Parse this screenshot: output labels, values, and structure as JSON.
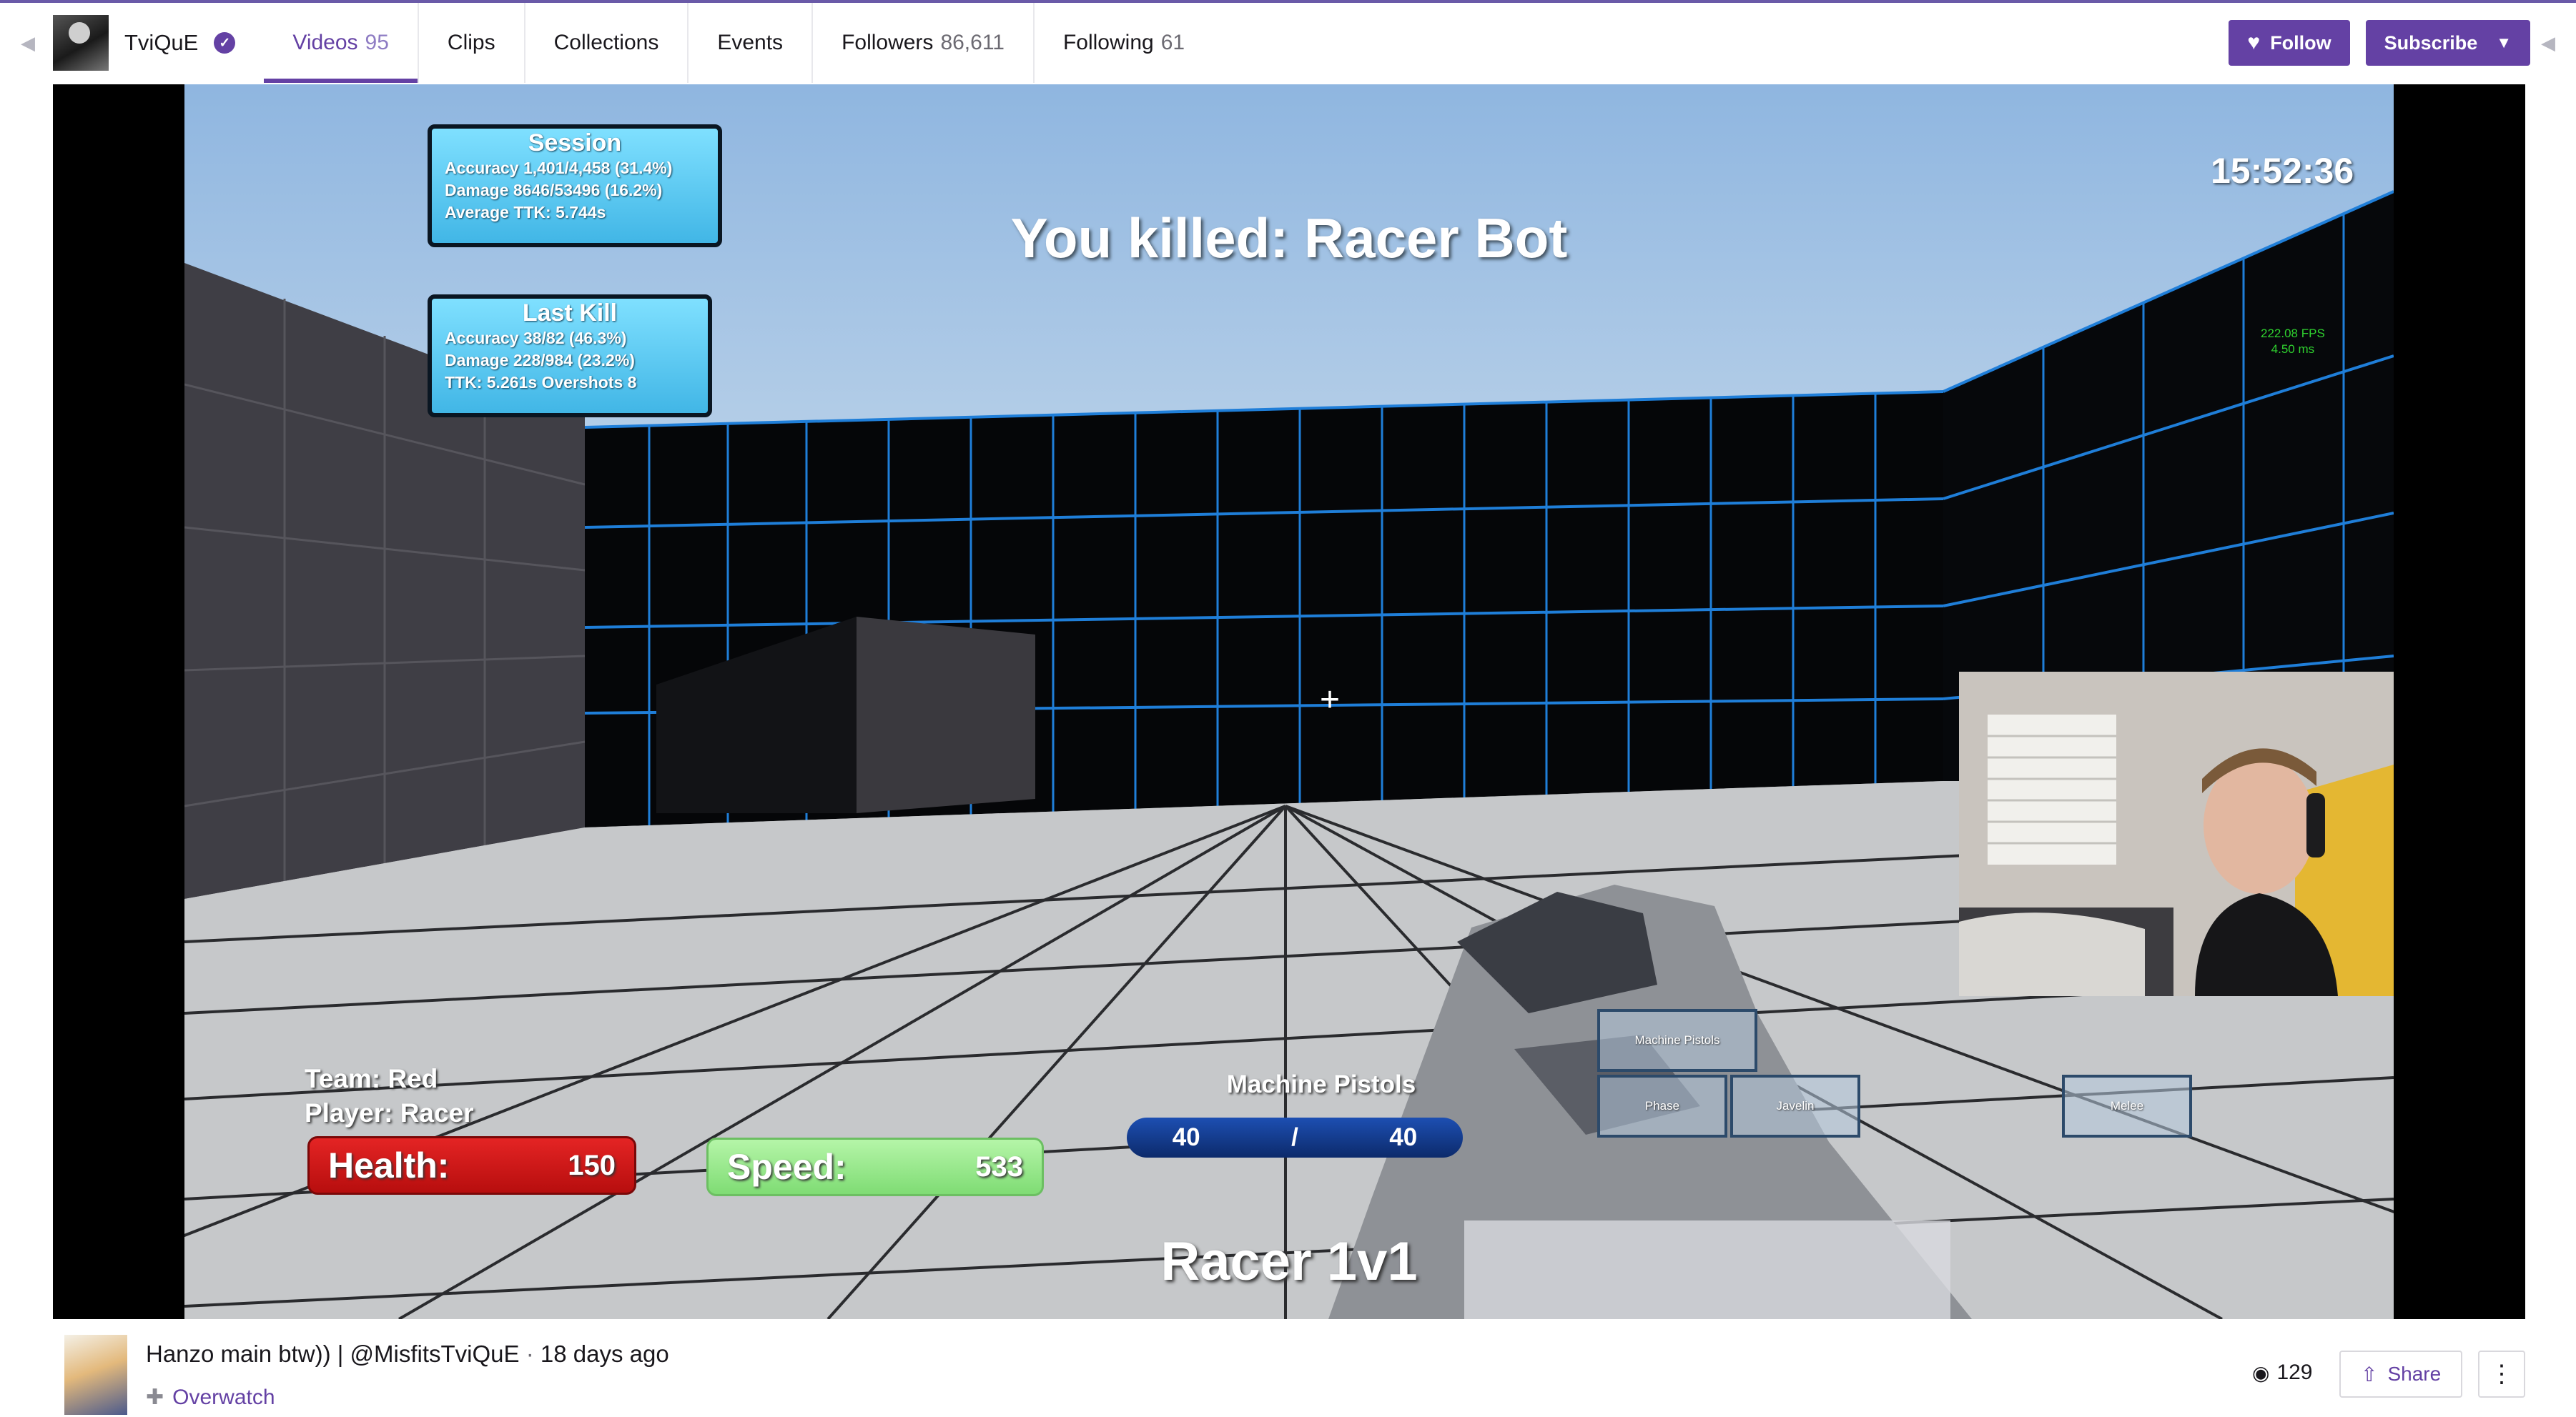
{
  "nav": {
    "channel_name": "TviQuE",
    "tabs": [
      {
        "label": "Videos",
        "count": "95"
      },
      {
        "label": "Clips",
        "count": ""
      },
      {
        "label": "Collections",
        "count": ""
      },
      {
        "label": "Events",
        "count": ""
      },
      {
        "label": "Followers",
        "count": "86,611"
      },
      {
        "label": "Following",
        "count": "61"
      }
    ],
    "follow_label": "Follow",
    "subscribe_label": "Subscribe",
    "accent_color": "#6441a4"
  },
  "hud": {
    "session": {
      "title": "Session",
      "lines": [
        "Accuracy 1,401/4,458 (31.4%)",
        "Damage 8646/53496 (16.2%)",
        "Average TTK: 5.744s"
      ]
    },
    "last_kill": {
      "title": "Last Kill",
      "lines": [
        "Accuracy 38/82 (46.3%)",
        "Damage 228/984 (23.2%)",
        "TTK: 5.261s Overshots 8"
      ]
    },
    "clock": "15:52:36",
    "fps_lines": [
      "222.08 FPS",
      "4.50 ms"
    ],
    "kill_message": "You killed: Racer Bot",
    "team": "Team: Red",
    "player": "Player: Racer",
    "health_label": "Health:",
    "health_value": "150",
    "speed_label": "Speed:",
    "speed_value": "533",
    "weapon_name": "Machine Pistols",
    "ammo_current": "40",
    "ammo_sep": "/",
    "ammo_max": "40",
    "mode": "Racer 1v1",
    "slots": [
      "Machine Pistols",
      "Phase",
      "Javelin",
      "Melee"
    ]
  },
  "video": {
    "title": "Hanzo main btw)) | @MisfitsTviQuE",
    "separator": "·",
    "age": "18 days ago",
    "game": "Overwatch",
    "views": "129",
    "share_label": "Share"
  }
}
